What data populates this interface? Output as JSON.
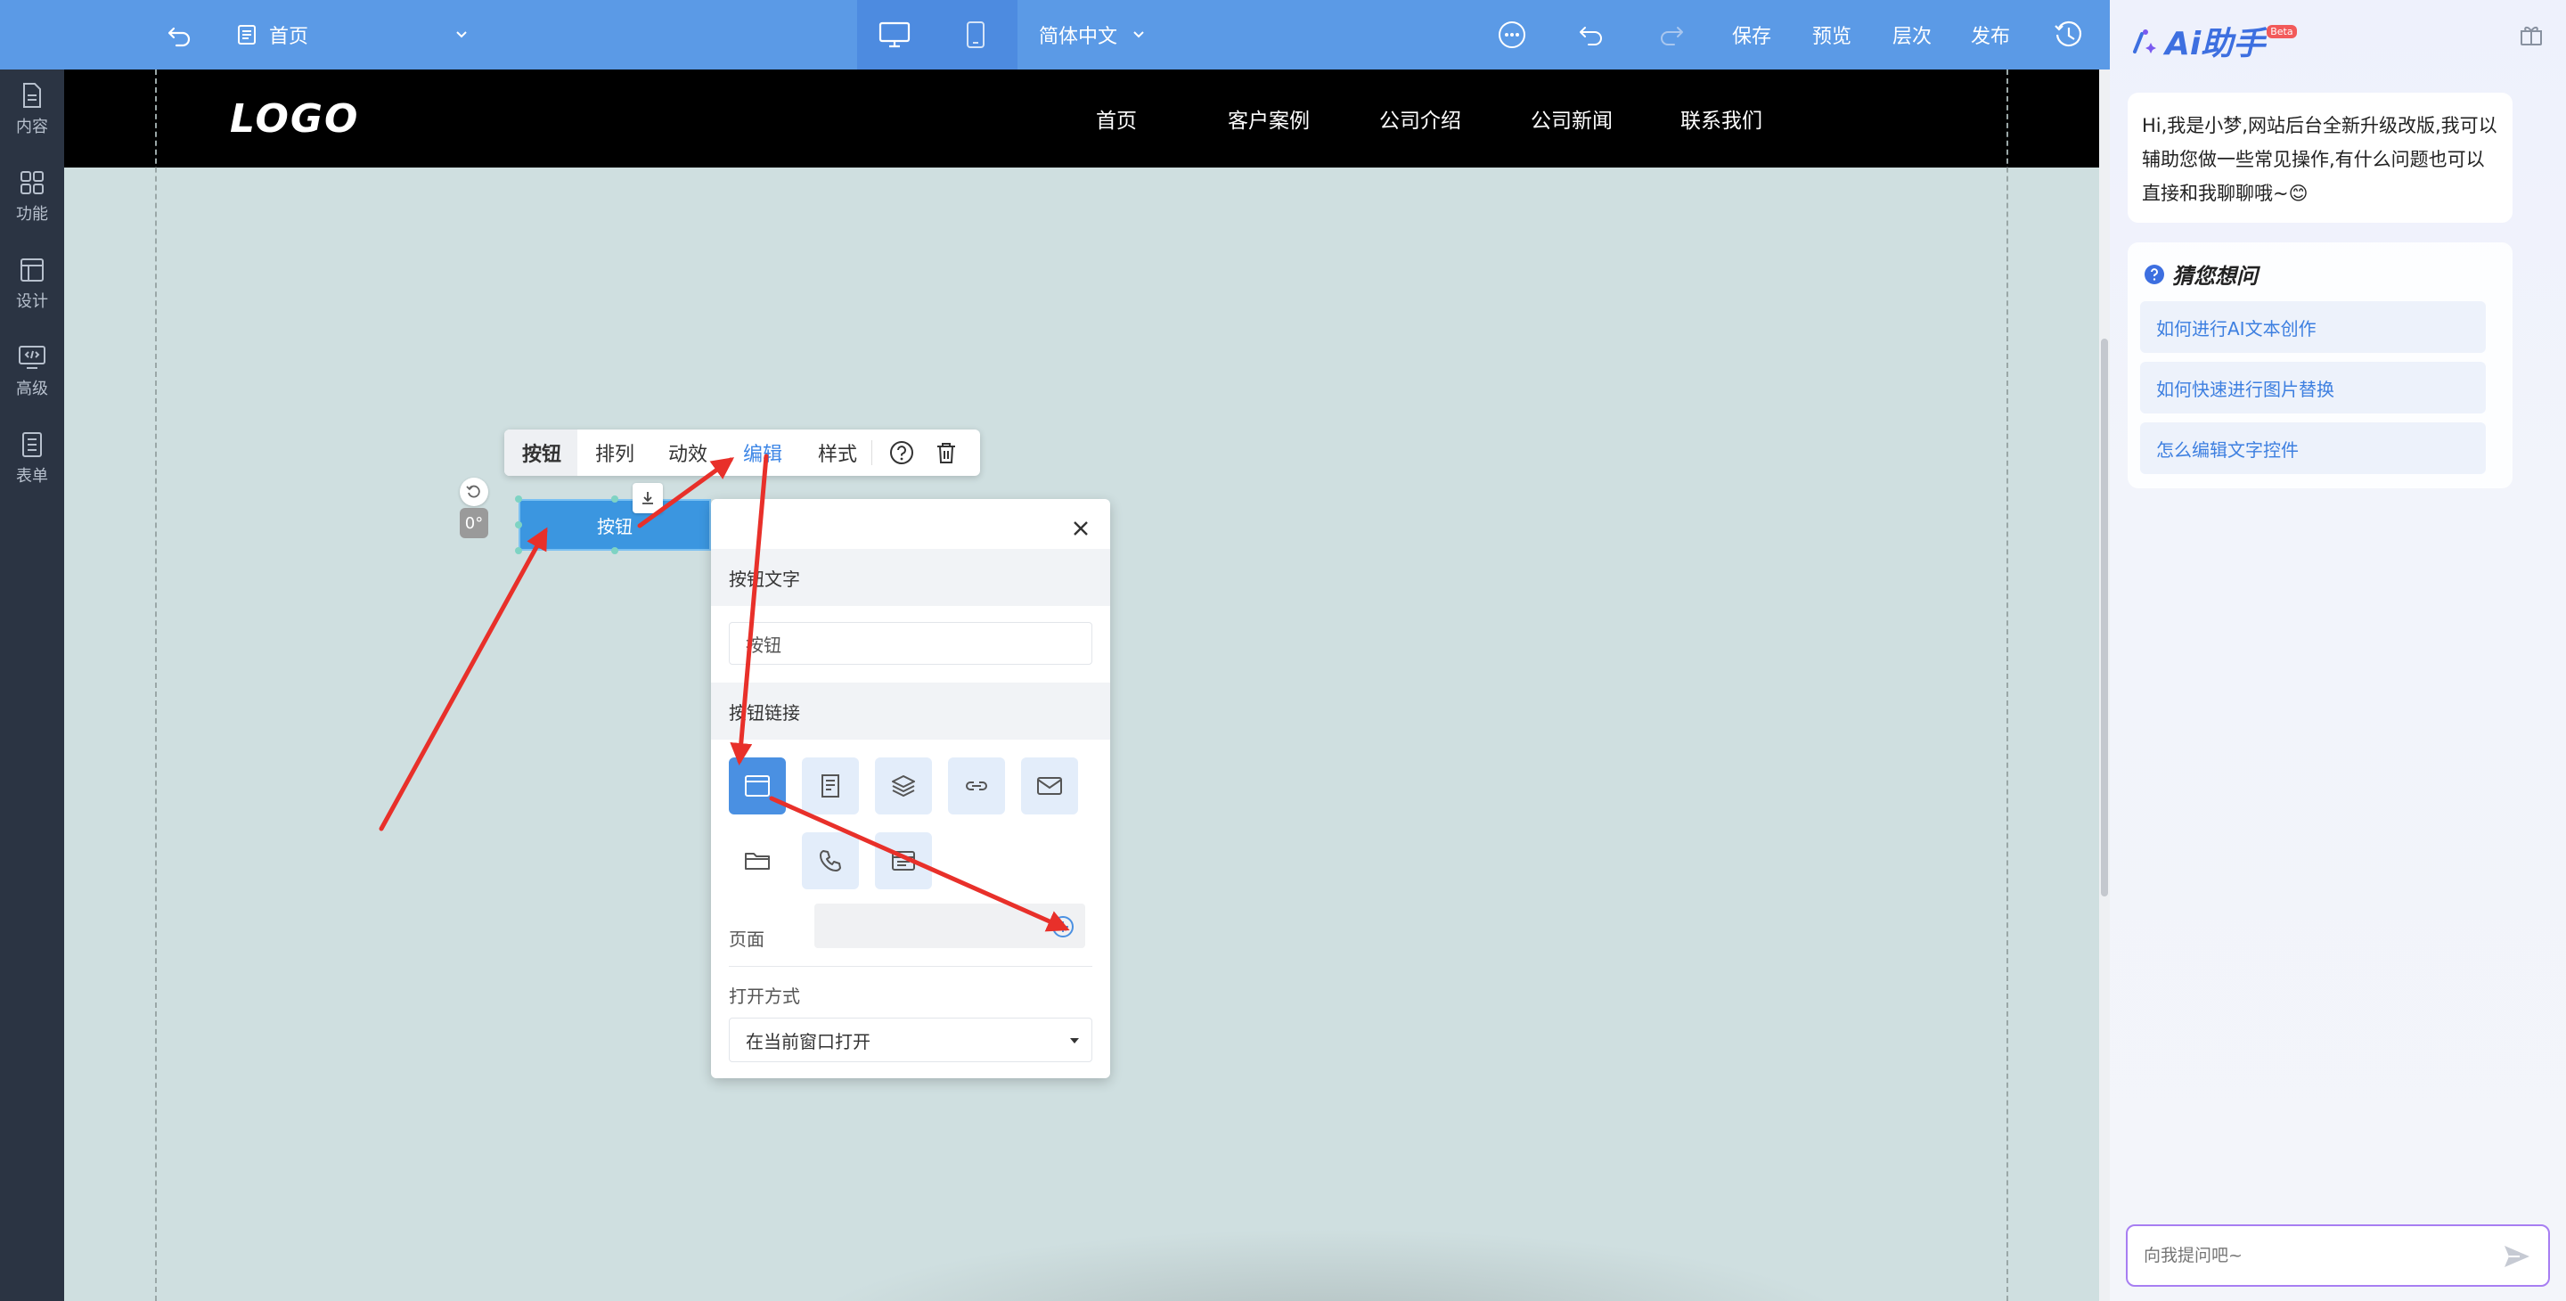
{
  "topbar": {
    "page_name": "首页",
    "language": "简体中文",
    "save": "保存",
    "preview": "预览",
    "layers": "层次",
    "publish": "发布"
  },
  "leftnav": [
    {
      "label": "内容",
      "icon": "document-icon"
    },
    {
      "label": "功能",
      "icon": "grid-icon"
    },
    {
      "label": "设计",
      "icon": "layout-icon"
    },
    {
      "label": "高级",
      "icon": "code-monitor-icon"
    },
    {
      "label": "表单",
      "icon": "form-icon"
    }
  ],
  "site": {
    "logo": "LOGO",
    "menu": [
      "首页",
      "客户案例",
      "公司介绍",
      "公司新闻",
      "联系我们"
    ]
  },
  "element": {
    "button_text": "按钮",
    "rotation": "0°"
  },
  "element_toolbar": {
    "type_label": "按钮",
    "arrange": "排列",
    "animation": "动效",
    "edit": "编辑",
    "style": "样式"
  },
  "panel": {
    "text_section": "按钮文字",
    "text_value": "按钮",
    "link_section": "按钮链接",
    "link_types": [
      "page-icon",
      "article-icon",
      "layers-icon",
      "link-icon",
      "email-icon",
      "folder-icon",
      "phone-icon",
      "form-icon"
    ],
    "page_label": "页面",
    "page_value": "",
    "open_label": "打开方式",
    "open_value": "在当前窗口打开"
  },
  "ai": {
    "title": "Ai助手",
    "badge": "Beta",
    "greeting": "Hi,我是小梦,网站后台全新升级改版,我可以辅助您做一些常见操作,有什么问题也可以直接和我聊聊哦~😊",
    "suggest_title": "猜您想问",
    "suggestions": [
      "如何进行AI文本创作",
      "如何快速进行图片替换",
      "怎么编辑文字控件"
    ],
    "input_placeholder": "向我提问吧~"
  },
  "colors": {
    "topbar": "#5b9ae6",
    "leftnav": "#2b3443",
    "canvas": "#cfdfe0",
    "accent": "#3b96e0",
    "annotation": "#e8302a"
  }
}
